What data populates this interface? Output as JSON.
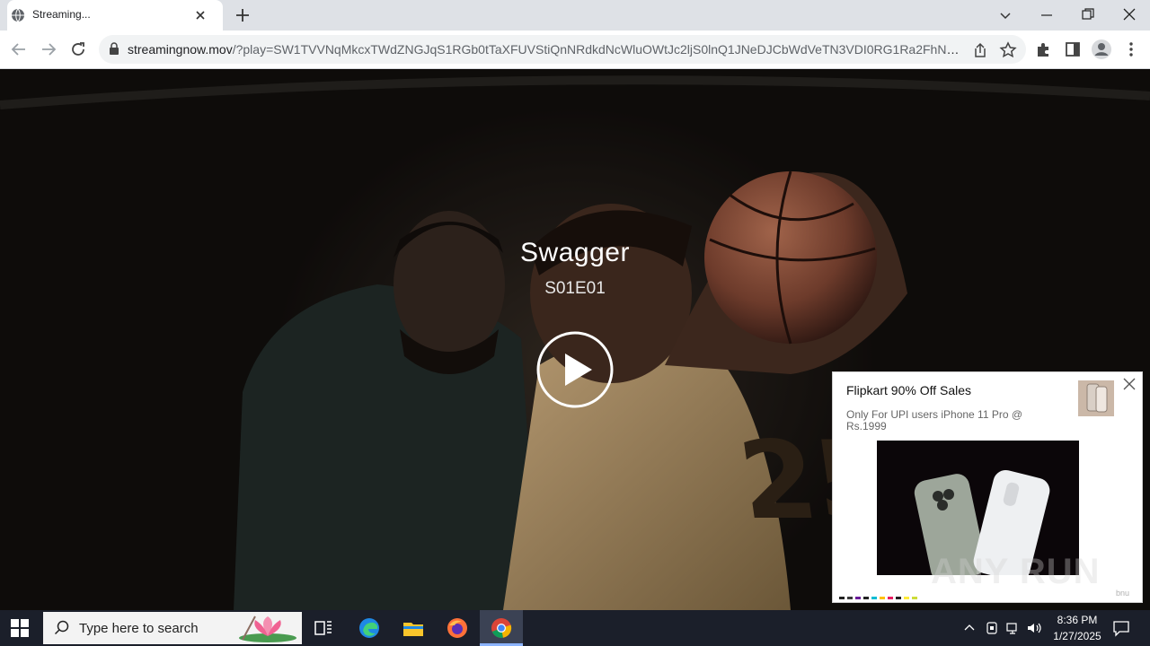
{
  "browser": {
    "tab": {
      "title": "Streaming..."
    },
    "address": {
      "host": "streamingnow.mov",
      "path": "/?play=SW1TVVNqMkcxTWdZNGJqS1RGb0tTaXFUVStiQnNRdkdNcWluOWtJc2ljS0lnQ1JNeDJCbWdVeTN3VDI0RG1Ra2FhNFc0ZiY..."
    },
    "icons": {
      "tab_favicon": "globe-icon",
      "tab_close": "close-icon",
      "new_tab": "plus-icon",
      "back": "arrow-left-icon",
      "forward": "arrow-right-icon",
      "reload": "reload-icon",
      "lock": "lock-icon",
      "share": "share-icon",
      "bookmark": "star-icon",
      "extensions": "puzzle-icon",
      "side_panel": "side-panel-icon",
      "profile": "person-icon",
      "menu": "kebab-menu-icon"
    }
  },
  "player": {
    "title": "Swagger",
    "episode": "S01E01",
    "play_icon": "play-icon"
  },
  "ad": {
    "title": "Flipkart 90% Off Sales",
    "description": "Only For UPI users iPhone 11 Pro @ Rs.1999",
    "brand": "bnu",
    "close_icon": "close-icon"
  },
  "watermark": {
    "text": "ANY RUN"
  },
  "taskbar": {
    "search_placeholder": "Type here to search",
    "time": "8:36 PM",
    "date": "1/27/2025",
    "apps": [
      "task-view",
      "edge",
      "file-explorer",
      "firefox",
      "chrome"
    ]
  },
  "colors": {
    "tabstrip": "#dee1e6",
    "taskbar": "#1b1f2a",
    "accent": "#8cb4ff"
  }
}
